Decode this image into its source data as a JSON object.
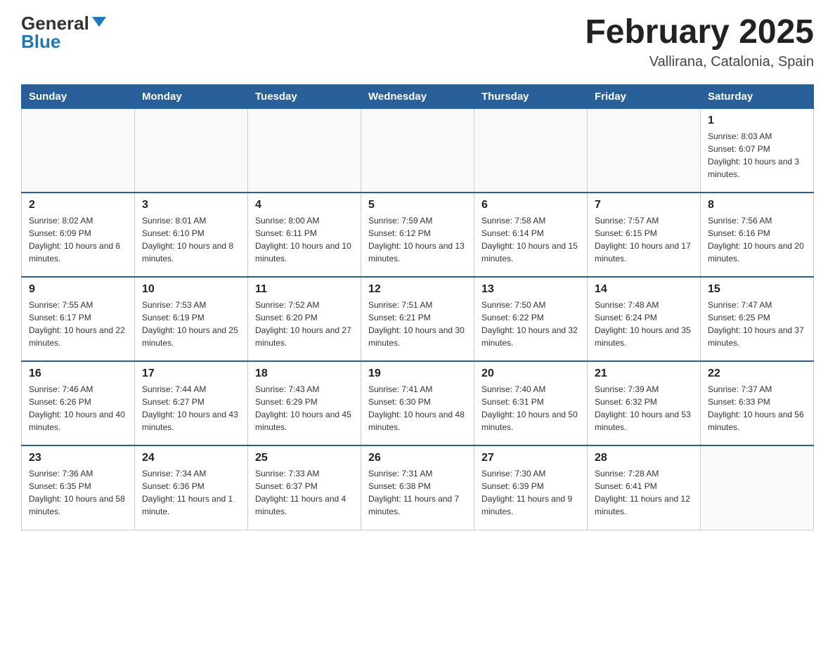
{
  "header": {
    "logo_general": "General",
    "logo_blue": "Blue",
    "title": "February 2025",
    "location": "Vallirana, Catalonia, Spain"
  },
  "weekdays": [
    "Sunday",
    "Monday",
    "Tuesday",
    "Wednesday",
    "Thursday",
    "Friday",
    "Saturday"
  ],
  "weeks": [
    [
      {
        "day": "",
        "info": ""
      },
      {
        "day": "",
        "info": ""
      },
      {
        "day": "",
        "info": ""
      },
      {
        "day": "",
        "info": ""
      },
      {
        "day": "",
        "info": ""
      },
      {
        "day": "",
        "info": ""
      },
      {
        "day": "1",
        "info": "Sunrise: 8:03 AM\nSunset: 6:07 PM\nDaylight: 10 hours and 3 minutes."
      }
    ],
    [
      {
        "day": "2",
        "info": "Sunrise: 8:02 AM\nSunset: 6:09 PM\nDaylight: 10 hours and 6 minutes."
      },
      {
        "day": "3",
        "info": "Sunrise: 8:01 AM\nSunset: 6:10 PM\nDaylight: 10 hours and 8 minutes."
      },
      {
        "day": "4",
        "info": "Sunrise: 8:00 AM\nSunset: 6:11 PM\nDaylight: 10 hours and 10 minutes."
      },
      {
        "day": "5",
        "info": "Sunrise: 7:59 AM\nSunset: 6:12 PM\nDaylight: 10 hours and 13 minutes."
      },
      {
        "day": "6",
        "info": "Sunrise: 7:58 AM\nSunset: 6:14 PM\nDaylight: 10 hours and 15 minutes."
      },
      {
        "day": "7",
        "info": "Sunrise: 7:57 AM\nSunset: 6:15 PM\nDaylight: 10 hours and 17 minutes."
      },
      {
        "day": "8",
        "info": "Sunrise: 7:56 AM\nSunset: 6:16 PM\nDaylight: 10 hours and 20 minutes."
      }
    ],
    [
      {
        "day": "9",
        "info": "Sunrise: 7:55 AM\nSunset: 6:17 PM\nDaylight: 10 hours and 22 minutes."
      },
      {
        "day": "10",
        "info": "Sunrise: 7:53 AM\nSunset: 6:19 PM\nDaylight: 10 hours and 25 minutes."
      },
      {
        "day": "11",
        "info": "Sunrise: 7:52 AM\nSunset: 6:20 PM\nDaylight: 10 hours and 27 minutes."
      },
      {
        "day": "12",
        "info": "Sunrise: 7:51 AM\nSunset: 6:21 PM\nDaylight: 10 hours and 30 minutes."
      },
      {
        "day": "13",
        "info": "Sunrise: 7:50 AM\nSunset: 6:22 PM\nDaylight: 10 hours and 32 minutes."
      },
      {
        "day": "14",
        "info": "Sunrise: 7:48 AM\nSunset: 6:24 PM\nDaylight: 10 hours and 35 minutes."
      },
      {
        "day": "15",
        "info": "Sunrise: 7:47 AM\nSunset: 6:25 PM\nDaylight: 10 hours and 37 minutes."
      }
    ],
    [
      {
        "day": "16",
        "info": "Sunrise: 7:46 AM\nSunset: 6:26 PM\nDaylight: 10 hours and 40 minutes."
      },
      {
        "day": "17",
        "info": "Sunrise: 7:44 AM\nSunset: 6:27 PM\nDaylight: 10 hours and 43 minutes."
      },
      {
        "day": "18",
        "info": "Sunrise: 7:43 AM\nSunset: 6:29 PM\nDaylight: 10 hours and 45 minutes."
      },
      {
        "day": "19",
        "info": "Sunrise: 7:41 AM\nSunset: 6:30 PM\nDaylight: 10 hours and 48 minutes."
      },
      {
        "day": "20",
        "info": "Sunrise: 7:40 AM\nSunset: 6:31 PM\nDaylight: 10 hours and 50 minutes."
      },
      {
        "day": "21",
        "info": "Sunrise: 7:39 AM\nSunset: 6:32 PM\nDaylight: 10 hours and 53 minutes."
      },
      {
        "day": "22",
        "info": "Sunrise: 7:37 AM\nSunset: 6:33 PM\nDaylight: 10 hours and 56 minutes."
      }
    ],
    [
      {
        "day": "23",
        "info": "Sunrise: 7:36 AM\nSunset: 6:35 PM\nDaylight: 10 hours and 58 minutes."
      },
      {
        "day": "24",
        "info": "Sunrise: 7:34 AM\nSunset: 6:36 PM\nDaylight: 11 hours and 1 minute."
      },
      {
        "day": "25",
        "info": "Sunrise: 7:33 AM\nSunset: 6:37 PM\nDaylight: 11 hours and 4 minutes."
      },
      {
        "day": "26",
        "info": "Sunrise: 7:31 AM\nSunset: 6:38 PM\nDaylight: 11 hours and 7 minutes."
      },
      {
        "day": "27",
        "info": "Sunrise: 7:30 AM\nSunset: 6:39 PM\nDaylight: 11 hours and 9 minutes."
      },
      {
        "day": "28",
        "info": "Sunrise: 7:28 AM\nSunset: 6:41 PM\nDaylight: 11 hours and 12 minutes."
      },
      {
        "day": "",
        "info": ""
      }
    ]
  ]
}
